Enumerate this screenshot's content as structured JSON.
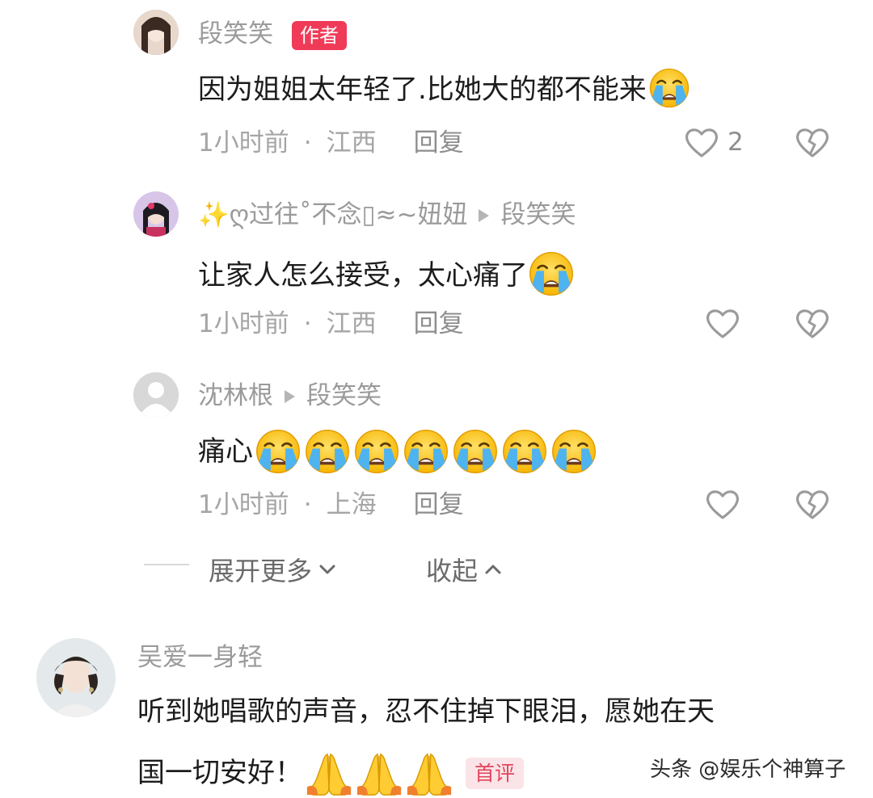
{
  "comments": [
    {
      "name": "段笑笑",
      "badge": "作者",
      "text": "因为姐姐太年轻了.比她大的都不能来",
      "time": "1小时前",
      "sep": "·",
      "location": "江西",
      "reply": "回复",
      "likes": "2"
    },
    {
      "name": "✨ღ过往˚不念▯≈~妞妞",
      "reply_to": "段笑笑",
      "text": "让家人怎么接受，太心痛了",
      "time": "1小时前",
      "sep": "·",
      "location": "江西",
      "reply": "回复"
    },
    {
      "name": "沈林根",
      "reply_to": "段笑笑",
      "text": "痛心",
      "time": "1小时前",
      "sep": "·",
      "location": "上海",
      "reply": "回复"
    },
    {
      "name": "吴爱一身轻",
      "text_line1": "听到她唱歌的声音，忍不住掉下眼泪，愿她在天",
      "text_line2": "国一切安好！",
      "badge": "首评"
    }
  ],
  "controls": {
    "expand_more": "展开更多",
    "collapse": "收起"
  },
  "watermark": "头条 @娱乐个神算子",
  "icons": [
    "heart-icon",
    "broken-heart-icon",
    "crying-emoji",
    "praying-hands-emoji",
    "chevron-down-icon",
    "chevron-up-icon"
  ]
}
